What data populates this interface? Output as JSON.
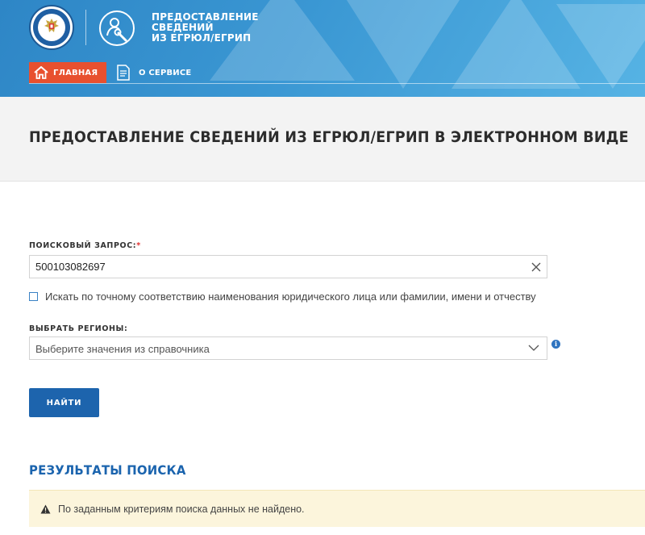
{
  "header": {
    "service_title_lines": [
      "ПРЕДОСТАВЛЕНИЕ",
      "СВЕДЕНИЙ",
      "ИЗ ЕГРЮЛ/ЕГРИП"
    ],
    "nav": {
      "home_label": "ГЛАВНАЯ",
      "about_label": "О СЕРВИСЕ"
    }
  },
  "page": {
    "title": "ПРЕДОСТАВЛЕНИЕ СВЕДЕНИЙ ИЗ ЕГРЮЛ/ЕГРИП В ЭЛЕКТРОННОМ ВИДЕ"
  },
  "form": {
    "query_label": "ПОИСКОВЫЙ ЗАПРОС:",
    "query_required_mark": "*",
    "query_value": "500103082697",
    "exact_match_label": "Искать по точному соответствию наименования юридического лица или фамилии, имени и отчеству",
    "exact_match_checked": false,
    "regions_label": "ВЫБРАТЬ РЕГИОНЫ:",
    "regions_placeholder": "Выберите значения из справочника",
    "find_button_label": "НАЙТИ"
  },
  "results": {
    "title": "РЕЗУЛЬТАТЫ ПОИСКА",
    "message": "По заданным критериям поиска данных не найдено."
  },
  "colors": {
    "header_blue": "#3a97d3",
    "nav_active": "#e8502f",
    "primary_button": "#1d64ad",
    "results_title": "#1b64ae",
    "alert_bg": "#fcf5dc",
    "required": "#e0302f"
  },
  "icons": {
    "logo": "fns-emblem",
    "service": "person-wrench-icon",
    "home": "home-icon",
    "about": "document-icon",
    "clear": "close-icon",
    "dropdown": "chevron-down-icon",
    "info": "info-icon",
    "warning": "warning-icon"
  }
}
